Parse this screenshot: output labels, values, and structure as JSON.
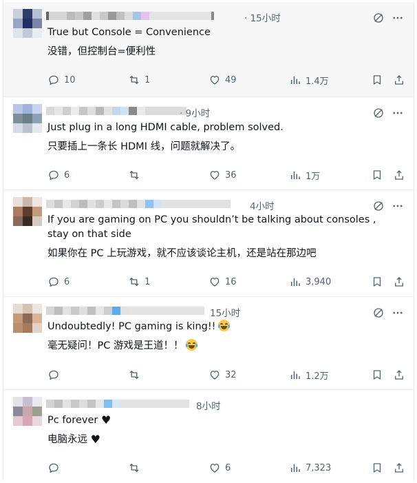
{
  "colors": {
    "text": "#0f1419",
    "muted": "#536471",
    "divider": "#e8ecee"
  },
  "posts": [
    {
      "time": "· 15小时",
      "text_en": "True but Console = Convenience",
      "text_zh": "没错，但控制台=便利性",
      "replies": "10",
      "reposts": "1",
      "likes": "49",
      "views": "1.4万"
    },
    {
      "time": "· 9小时",
      "text_en": "Just plug in a long HDMI cable, problem solved.",
      "text_zh": "只要插上一条长 HDMI 线，问题就解决了。",
      "replies": "6",
      "reposts": "",
      "likes": "36",
      "views": "1万"
    },
    {
      "time": "4小时",
      "text_en": "If you are gaming on PC you shouldn’t be talking about consoles , stay on that side",
      "text_zh": "如果你在 PC 上玩游戏，就不应该谈论主机，还是站在那边吧",
      "replies": "6",
      "reposts": "1",
      "likes": "16",
      "views": "3,940"
    },
    {
      "time": "15小时",
      "text_en": "Undoubtedly! PC gaming is king!!",
      "text_zh": "毫无疑问！PC 游戏是王道！！",
      "replies": "",
      "reposts": "",
      "likes": "32",
      "views": "1.2万"
    },
    {
      "time": "8小时",
      "text_en": "Pc forever",
      "text_zh": "电脑永远",
      "replies": "",
      "reposts": "",
      "likes": "6",
      "views": "7,323"
    }
  ],
  "icons": [
    "grok-icon",
    "more-icon",
    "reply-icon",
    "repost-icon",
    "like-icon",
    "views-icon",
    "bookmark-icon",
    "share-icon",
    "black-heart-emoji",
    "laughing-tears-emoji"
  ]
}
